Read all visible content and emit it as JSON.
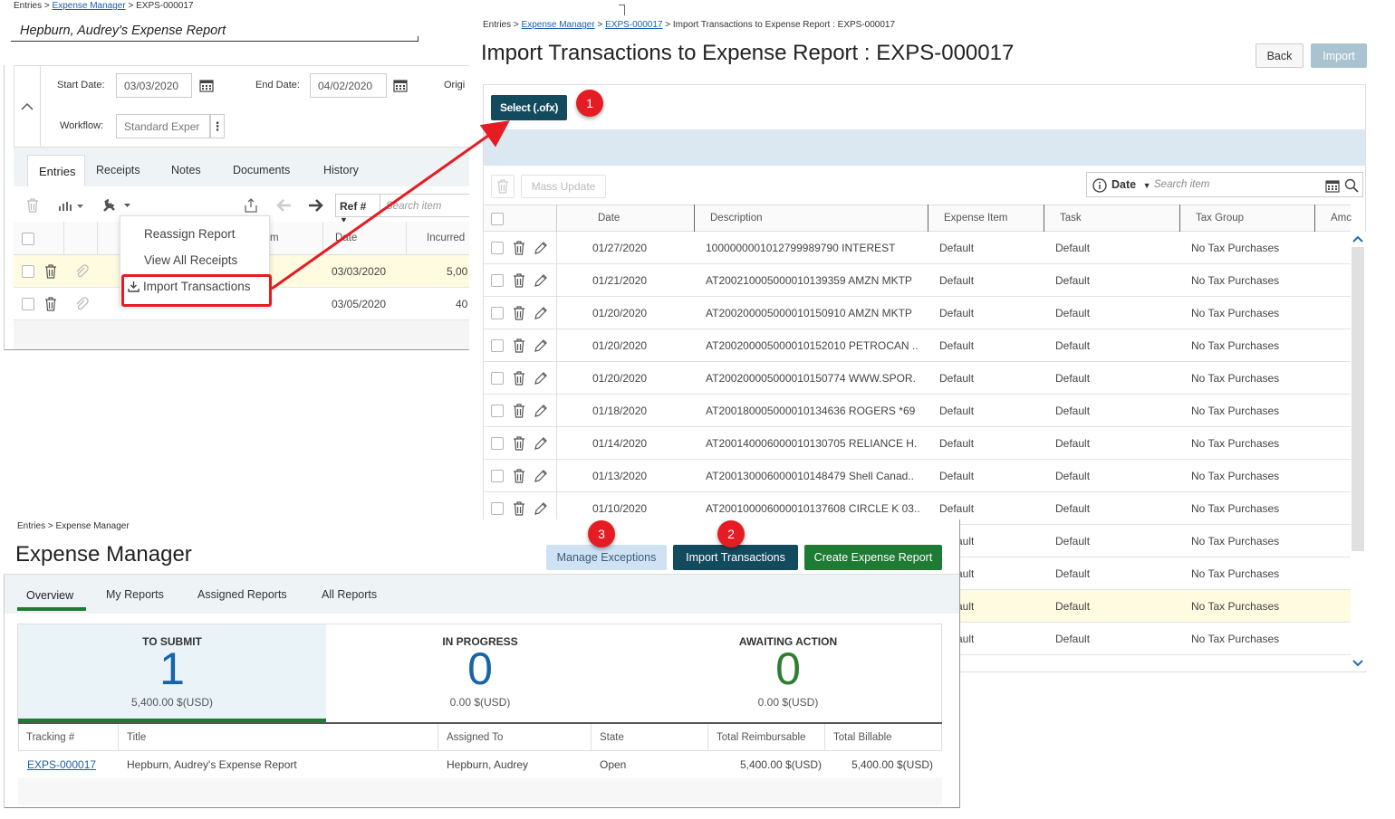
{
  "report_screen": {
    "breadcrumb": {
      "entries": "Entries",
      "sep": ">",
      "manager": "Expense Manager",
      "id": "EXPS-000017"
    },
    "title": "Hepburn, Audrey's Expense Report",
    "start_label": "Start Date:",
    "start_value": "03/03/2020",
    "end_label": "End Date:",
    "end_value": "04/02/2020",
    "origin_label": "Origi",
    "workflow_label": "Workflow:",
    "workflow_value": "Standard Exper",
    "tabs": [
      "Entries",
      "Receipts",
      "Notes",
      "Documents",
      "History"
    ],
    "ref_select": "Ref #",
    "search_placeholder": "Search item",
    "col_date": "Date",
    "col_incurred": "Incurred",
    "col_item_partial": "m",
    "rows": [
      {
        "date": "03/03/2020",
        "amount": "5,00"
      },
      {
        "date": "03/05/2020",
        "amount": "40"
      }
    ],
    "menu": {
      "reassign": "Reassign Report",
      "view_receipts": "View All Receipts",
      "import": "Import Transactions"
    }
  },
  "import_screen": {
    "breadcrumb": {
      "entries": "Entries",
      "sep": ">",
      "manager": "Expense Manager",
      "id": "EXPS-000017",
      "current": "Import Transactions to Expense Report : EXPS-000017"
    },
    "title": "Import Transactions to Expense Report : EXPS-000017",
    "back": "Back",
    "import": "Import",
    "select": "Select (.ofx)",
    "mass_update": "Mass Update",
    "date_filter": "Date",
    "search_placeholder": "Search item",
    "columns": {
      "date": "Date",
      "description": "Description",
      "expense_item": "Expense Item",
      "task": "Task",
      "tax_group": "Tax Group",
      "amount": "Amc"
    },
    "rows": [
      {
        "date": "01/27/2020",
        "desc": "1000000001012799989790 INTEREST",
        "item": "Default",
        "task": "Default",
        "tax": "No Tax Purchases"
      },
      {
        "date": "01/21/2020",
        "desc": "AT20021000500001013935­9 AMZN MKTP",
        "item": "Default",
        "task": "Default",
        "tax": "No Tax Purchases"
      },
      {
        "date": "01/20/2020",
        "desc": "AT200200005000010150910 AMZN MKTP",
        "item": "Default",
        "task": "Default",
        "tax": "No Tax Purchases"
      },
      {
        "date": "01/20/2020",
        "desc": "AT200200005000010152010 PETROCAN ..",
        "item": "Default",
        "task": "Default",
        "tax": "No Tax Purchases"
      },
      {
        "date": "01/20/2020",
        "desc": "AT200200005000010150774 WWW.SPOR.",
        "item": "Default",
        "task": "Default",
        "tax": "No Tax Purchases"
      },
      {
        "date": "01/18/2020",
        "desc": "AT200180005000010134636 ROGERS *69",
        "item": "Default",
        "task": "Default",
        "tax": "No Tax Purchases"
      },
      {
        "date": "01/14/2020",
        "desc": "AT200140006000010130705 RELIANCE H.",
        "item": "Default",
        "task": "Default",
        "tax": "No Tax Purchases"
      },
      {
        "date": "01/13/2020",
        "desc": "AT200130006000010148479 Shell Canad..",
        "item": "Default",
        "task": "Default",
        "tax": "No Tax Purchases"
      },
      {
        "date": "01/10/2020",
        "desc": "AT200100006000010137608 CIRCLE K 03..",
        "item": "Default",
        "task": "Default",
        "tax": "No Tax Purchases"
      },
      {
        "date": "",
        "desc": "",
        "item": "ault",
        "task": "Default",
        "tax": "No Tax Purchases"
      },
      {
        "date": "",
        "desc": "",
        "item": "ault",
        "task": "Default",
        "tax": "No Tax Purchases"
      },
      {
        "date": "",
        "desc": "",
        "item": "ault",
        "task": "Default",
        "tax": "No Tax Purchases"
      },
      {
        "date": "",
        "desc": "",
        "item": "ault",
        "task": "Default",
        "tax": "No Tax Purchases"
      }
    ]
  },
  "manager_screen": {
    "breadcrumb": {
      "entries": "Entries",
      "sep": ">",
      "manager": "Expense Manager"
    },
    "title": "Expense Manager",
    "btn_exceptions": "Manage Exceptions",
    "btn_import": "Import Transactions",
    "btn_create": "Create Expense Report",
    "tabs": [
      "Overview",
      "My Reports",
      "Assigned Reports",
      "All Reports"
    ],
    "kpis": [
      {
        "label": "TO SUBMIT",
        "value": "1",
        "amount": "5,400.00 $(USD)",
        "color": "#1565a8"
      },
      {
        "label": "IN PROGRESS",
        "value": "0",
        "amount": "0.00 $(USD)",
        "color": "#1565a8"
      },
      {
        "label": "AWAITING ACTION",
        "value": "0",
        "amount": "0.00 $(USD)",
        "color": "#2e7d32"
      }
    ],
    "columns": {
      "tracking": "Tracking #",
      "title": "Title",
      "assigned": "Assigned To",
      "state": "State",
      "reimb": "Total Reimbursable",
      "billable": "Total Billable"
    },
    "row": {
      "tracking": "EXPS-000017",
      "title": "Hepburn, Audrey's Expense Report",
      "assigned": "Hepburn, Audrey",
      "state": "Open",
      "reimb": "5,400.00 $(USD)",
      "billable": "5,400.00 $(USD)"
    }
  },
  "badges": [
    "1",
    "2",
    "3"
  ],
  "colors": {
    "dark_teal": "#134a5e",
    "green": "#1e7b34",
    "light_blue": "#cfe2f3",
    "highlight": "#fffbe0",
    "annotation_red": "#e51c23",
    "link": "#1a5fa8"
  }
}
